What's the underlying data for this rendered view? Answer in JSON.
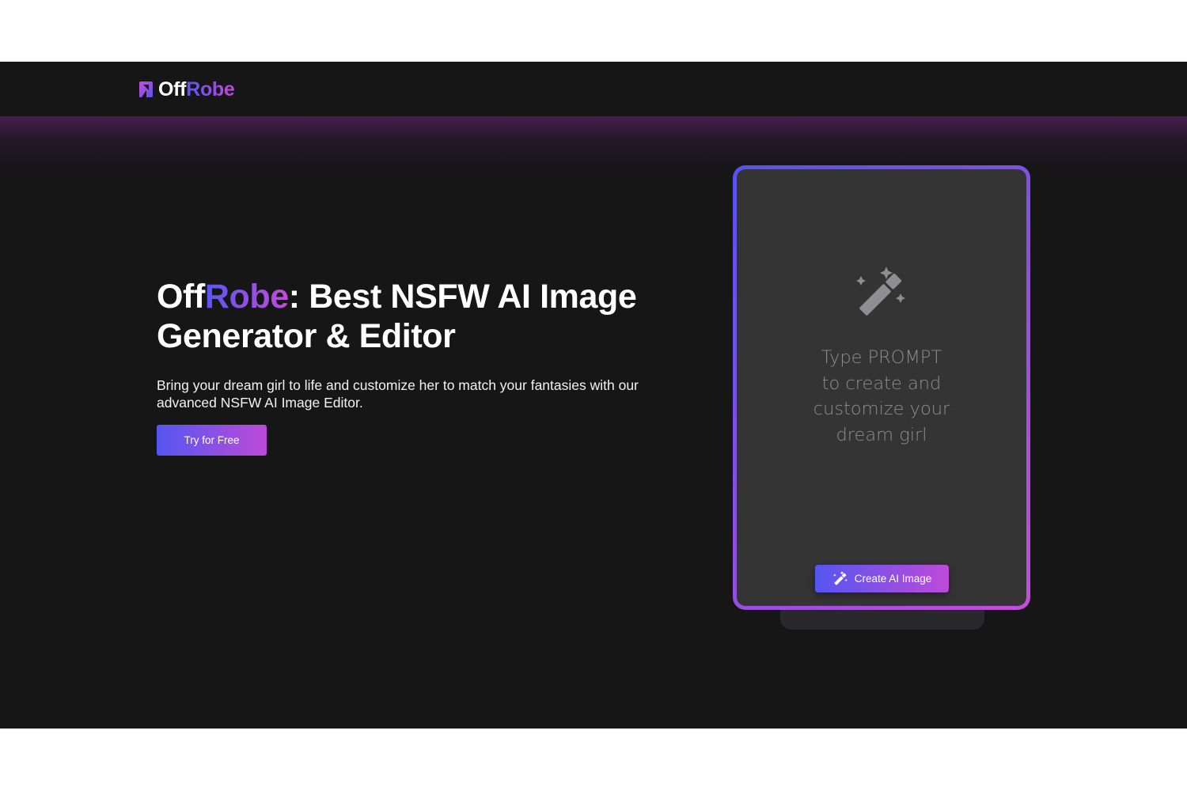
{
  "header": {
    "logo_prefix": "Off",
    "logo_suffix": "Robe"
  },
  "hero": {
    "title_brand_prefix": "Off",
    "title_brand_suffix": "Robe",
    "title_rest_line1": ": Best NSFW AI Image",
    "title_line2": "Generator & Editor",
    "subtitle": "Bring your dream girl to life and customize her to match your fantasies with our advanced NSFW AI Image Editor.",
    "cta_label": "Try for Free"
  },
  "card": {
    "icon": "magic-wand-icon",
    "prompt_lines": [
      "Type PROMPT",
      "to create and",
      "customize your",
      "dream girl"
    ],
    "create_button_label": "Create AI Image"
  },
  "colors": {
    "background": "#161617",
    "accent_start": "#5556f0",
    "accent_end": "#bd4ad9",
    "card_bg": "#343435"
  }
}
